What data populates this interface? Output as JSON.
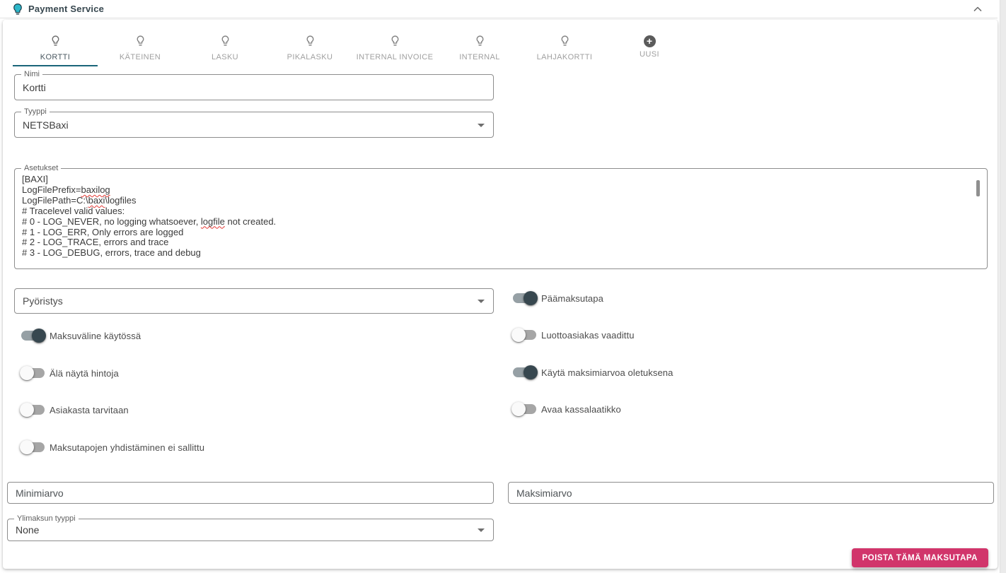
{
  "header": {
    "title": "Payment Service",
    "icon": "lightbulb-icon",
    "collapse_icon": "chevron-up-icon"
  },
  "tabs": [
    {
      "label": "KORTTI",
      "icon": "lightbulb-icon",
      "active": true
    },
    {
      "label": "KÄTEINEN",
      "icon": "lightbulb-icon",
      "active": false
    },
    {
      "label": "LASKU",
      "icon": "lightbulb-icon",
      "active": false
    },
    {
      "label": "PIKALASKU",
      "icon": "lightbulb-icon",
      "active": false
    },
    {
      "label": "INTERNAL INVOICE",
      "icon": "lightbulb-icon",
      "active": false
    },
    {
      "label": "INTERNAL",
      "icon": "lightbulb-icon",
      "active": false
    },
    {
      "label": "LAHJAKORTTI",
      "icon": "lightbulb-icon",
      "active": false
    },
    {
      "label": "UUSI",
      "icon": "plus-icon",
      "active": false
    }
  ],
  "form": {
    "name": {
      "label": "Nimi",
      "value": "Kortti"
    },
    "type": {
      "label": "Tyyppi",
      "value": "NETSBaxi"
    },
    "settings": {
      "label": "Asetukset",
      "lines": [
        "[BAXI]",
        "LogFilePrefix=baxilog",
        "LogFilePath=C:\\baxi\\logfiles",
        "# Tracelevel valid values:",
        "# 0 - LOG_NEVER, no logging whatsoever, logfile not created.",
        "# 1 - LOG_ERR, Only errors are logged",
        "# 2 - LOG_TRACE, errors and trace",
        "# 3 - LOG_DEBUG, errors, trace and debug"
      ],
      "misspelled": [
        "baxilog",
        "baxi",
        "logfile"
      ]
    },
    "rounding": {
      "placeholder": "Pyöristys"
    },
    "toggles_left": [
      {
        "label": "Maksuväline käytössä",
        "on": true
      },
      {
        "label": "Älä näytä hintoja",
        "on": false
      },
      {
        "label": "Asiakasta tarvitaan",
        "on": false
      },
      {
        "label": "Maksutapojen yhdistäminen ei sallittu",
        "on": false
      }
    ],
    "toggles_right": [
      {
        "label": "Päämaksutapa",
        "on": true
      },
      {
        "label": "Luottoasiakas vaadittu",
        "on": false
      },
      {
        "label": "Käytä maksimiarvoa oletuksena",
        "on": true
      },
      {
        "label": "Avaa kassalaatikko",
        "on": false
      }
    ],
    "min_value": {
      "placeholder": "Minimiarvo",
      "value": ""
    },
    "max_value": {
      "placeholder": "Maksimiarvo",
      "value": ""
    },
    "overpay_type": {
      "label": "Ylimaksun tyyppi",
      "value": "None"
    }
  },
  "actions": {
    "delete_label": "POISTA TÄMÄ MAKSUTAPA"
  },
  "colors": {
    "accent_teal": "#1a6579",
    "bulb_fill": "#2db7c9",
    "danger": "#d1356b",
    "toggle_on_thumb": "#37474f"
  }
}
